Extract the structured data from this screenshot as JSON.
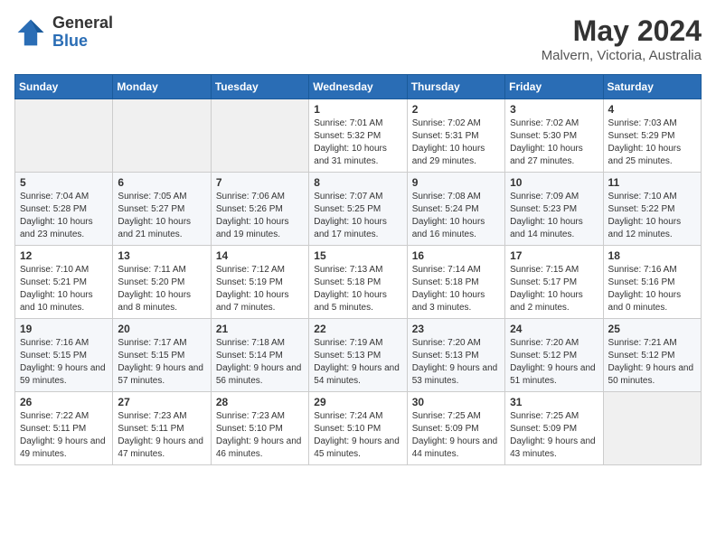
{
  "header": {
    "logo_general": "General",
    "logo_blue": "Blue",
    "main_title": "May 2024",
    "subtitle": "Malvern, Victoria, Australia"
  },
  "days_of_week": [
    "Sunday",
    "Monday",
    "Tuesday",
    "Wednesday",
    "Thursday",
    "Friday",
    "Saturday"
  ],
  "weeks": [
    [
      {
        "day": "",
        "sunrise": "",
        "sunset": "",
        "daylight": "",
        "empty": true
      },
      {
        "day": "",
        "sunrise": "",
        "sunset": "",
        "daylight": "",
        "empty": true
      },
      {
        "day": "",
        "sunrise": "",
        "sunset": "",
        "daylight": "",
        "empty": true
      },
      {
        "day": "1",
        "sunrise": "7:01 AM",
        "sunset": "5:32 PM",
        "daylight": "10 hours and 31 minutes."
      },
      {
        "day": "2",
        "sunrise": "7:02 AM",
        "sunset": "5:31 PM",
        "daylight": "10 hours and 29 minutes."
      },
      {
        "day": "3",
        "sunrise": "7:02 AM",
        "sunset": "5:30 PM",
        "daylight": "10 hours and 27 minutes."
      },
      {
        "day": "4",
        "sunrise": "7:03 AM",
        "sunset": "5:29 PM",
        "daylight": "10 hours and 25 minutes."
      }
    ],
    [
      {
        "day": "5",
        "sunrise": "7:04 AM",
        "sunset": "5:28 PM",
        "daylight": "10 hours and 23 minutes."
      },
      {
        "day": "6",
        "sunrise": "7:05 AM",
        "sunset": "5:27 PM",
        "daylight": "10 hours and 21 minutes."
      },
      {
        "day": "7",
        "sunrise": "7:06 AM",
        "sunset": "5:26 PM",
        "daylight": "10 hours and 19 minutes."
      },
      {
        "day": "8",
        "sunrise": "7:07 AM",
        "sunset": "5:25 PM",
        "daylight": "10 hours and 17 minutes."
      },
      {
        "day": "9",
        "sunrise": "7:08 AM",
        "sunset": "5:24 PM",
        "daylight": "10 hours and 16 minutes."
      },
      {
        "day": "10",
        "sunrise": "7:09 AM",
        "sunset": "5:23 PM",
        "daylight": "10 hours and 14 minutes."
      },
      {
        "day": "11",
        "sunrise": "7:10 AM",
        "sunset": "5:22 PM",
        "daylight": "10 hours and 12 minutes."
      }
    ],
    [
      {
        "day": "12",
        "sunrise": "7:10 AM",
        "sunset": "5:21 PM",
        "daylight": "10 hours and 10 minutes."
      },
      {
        "day": "13",
        "sunrise": "7:11 AM",
        "sunset": "5:20 PM",
        "daylight": "10 hours and 8 minutes."
      },
      {
        "day": "14",
        "sunrise": "7:12 AM",
        "sunset": "5:19 PM",
        "daylight": "10 hours and 7 minutes."
      },
      {
        "day": "15",
        "sunrise": "7:13 AM",
        "sunset": "5:18 PM",
        "daylight": "10 hours and 5 minutes."
      },
      {
        "day": "16",
        "sunrise": "7:14 AM",
        "sunset": "5:18 PM",
        "daylight": "10 hours and 3 minutes."
      },
      {
        "day": "17",
        "sunrise": "7:15 AM",
        "sunset": "5:17 PM",
        "daylight": "10 hours and 2 minutes."
      },
      {
        "day": "18",
        "sunrise": "7:16 AM",
        "sunset": "5:16 PM",
        "daylight": "10 hours and 0 minutes."
      }
    ],
    [
      {
        "day": "19",
        "sunrise": "7:16 AM",
        "sunset": "5:15 PM",
        "daylight": "9 hours and 59 minutes."
      },
      {
        "day": "20",
        "sunrise": "7:17 AM",
        "sunset": "5:15 PM",
        "daylight": "9 hours and 57 minutes."
      },
      {
        "day": "21",
        "sunrise": "7:18 AM",
        "sunset": "5:14 PM",
        "daylight": "9 hours and 56 minutes."
      },
      {
        "day": "22",
        "sunrise": "7:19 AM",
        "sunset": "5:13 PM",
        "daylight": "9 hours and 54 minutes."
      },
      {
        "day": "23",
        "sunrise": "7:20 AM",
        "sunset": "5:13 PM",
        "daylight": "9 hours and 53 minutes."
      },
      {
        "day": "24",
        "sunrise": "7:20 AM",
        "sunset": "5:12 PM",
        "daylight": "9 hours and 51 minutes."
      },
      {
        "day": "25",
        "sunrise": "7:21 AM",
        "sunset": "5:12 PM",
        "daylight": "9 hours and 50 minutes."
      }
    ],
    [
      {
        "day": "26",
        "sunrise": "7:22 AM",
        "sunset": "5:11 PM",
        "daylight": "9 hours and 49 minutes."
      },
      {
        "day": "27",
        "sunrise": "7:23 AM",
        "sunset": "5:11 PM",
        "daylight": "9 hours and 47 minutes."
      },
      {
        "day": "28",
        "sunrise": "7:23 AM",
        "sunset": "5:10 PM",
        "daylight": "9 hours and 46 minutes."
      },
      {
        "day": "29",
        "sunrise": "7:24 AM",
        "sunset": "5:10 PM",
        "daylight": "9 hours and 45 minutes."
      },
      {
        "day": "30",
        "sunrise": "7:25 AM",
        "sunset": "5:09 PM",
        "daylight": "9 hours and 44 minutes."
      },
      {
        "day": "31",
        "sunrise": "7:25 AM",
        "sunset": "5:09 PM",
        "daylight": "9 hours and 43 minutes."
      },
      {
        "day": "",
        "sunrise": "",
        "sunset": "",
        "daylight": "",
        "empty": true
      }
    ]
  ],
  "labels": {
    "sunrise_prefix": "Sunrise: ",
    "sunset_prefix": "Sunset: ",
    "daylight_prefix": "Daylight: "
  }
}
